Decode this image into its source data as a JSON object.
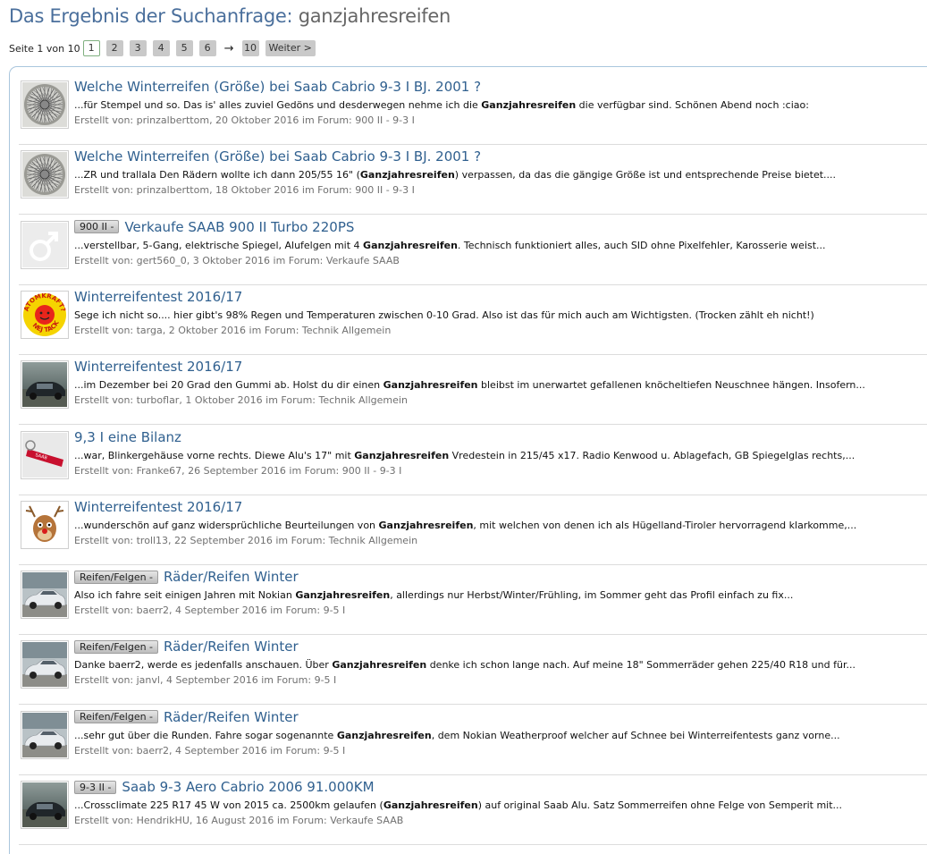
{
  "header": {
    "label": "Das Ergebnis der Suchanfrage:",
    "term": "ganzjahresreifen"
  },
  "pagination": {
    "info": "Seite 1 von 10",
    "pages": [
      "1",
      "2",
      "3",
      "4",
      "5",
      "6"
    ],
    "current": "1",
    "ellipsis": "→",
    "last": "10",
    "next": "Weiter >"
  },
  "results": [
    {
      "prefix": "",
      "title": "Welche Winterreifen (Größe) bei Saab Cabrio 9-3 I BJ. 2001 ?",
      "snippet_before": "...für Stempel und so. Das is' alles zuviel Gedöns und desderwegen nehme ich die ",
      "snippet_match": "Ganzjahresreifen",
      "snippet_after": " die verfügbar sind. Schönen Abend noch :ciao:",
      "meta": "Erstellt von: prinzalberttom, 20 Oktober 2016 im Forum: 900 II - 9-3 I",
      "icon": "wire-wheel-icon"
    },
    {
      "prefix": "",
      "title": "Welche Winterreifen (Größe) bei Saab Cabrio 9-3 I BJ. 2001 ?",
      "snippet_before": "...ZR und trallala Den Rädern wollte ich dann 205/55 16\" (",
      "snippet_match": "Ganzjahresreifen",
      "snippet_after": ") verpassen, da das die gängige Größe ist und entsprechende Preise bietet....",
      "meta": "Erstellt von: prinzalberttom, 18 Oktober 2016 im Forum: 900 II - 9-3 I",
      "icon": "wire-wheel-icon"
    },
    {
      "prefix": "900 II -",
      "title": "Verkaufe SAAB 900 II Turbo 220PS",
      "snippet_before": "...verstellbar, 5-Gang, elektrische Spiegel, Alufelgen mit 4 ",
      "snippet_match": "Ganzjahresreifen",
      "snippet_after": ". Technisch funktioniert alles, auch SID ohne Pixelfehler, Karosserie weist...",
      "meta": "Erstellt von: gert560_0, 3 Oktober 2016 im Forum: Verkaufe SAAB",
      "icon": "male-symbol-icon"
    },
    {
      "prefix": "",
      "title": "Winterreifentest 2016/17",
      "snippet_before": "Sege ich nicht so.... hier gibt's 98% Regen und Temperaturen zwischen 0-10 Grad. Also ist das für mich auch am Wichtigsten. (Trocken zählt eh nicht!)",
      "snippet_match": "",
      "snippet_after": "",
      "meta": "Erstellt von: targa, 2 Oktober 2016 im Forum: Technik Allgemein",
      "icon": "atomkraft-badge-icon",
      "badge_top": "ATOMKRAFT?",
      "badge_bottom": "NEJ TACK"
    },
    {
      "prefix": "",
      "title": "Winterreifentest 2016/17",
      "snippet_before": "...im Dezember bei 20 Grad den Gummi ab. Holst du dir einen ",
      "snippet_match": "Ganzjahresreifen",
      "snippet_after": " bleibst im unerwartet gefallenen knöcheltiefen Neuschnee hängen. Insofern...",
      "meta": "Erstellt von: turboflar, 1 Oktober 2016 im Forum: Technik Allgemein",
      "icon": "dark-car-photo-icon"
    },
    {
      "prefix": "",
      "title": "9,3 I eine Bilanz",
      "snippet_before": "...war, Blinkergehäuse vorne rechts. Diewe Alu's 17\" mit ",
      "snippet_match": "Ganzjahresreifen",
      "snippet_after": " Vredestein in 215/45 x17. Radio Kenwood u. Ablagefach, GB Spiegelglas rechts,...",
      "meta": "Erstellt von: Franke67, 26 September 2016 im Forum: 900 II - 9-3 I",
      "icon": "keychain-photo-icon"
    },
    {
      "prefix": "",
      "title": "Winterreifentest 2016/17",
      "snippet_before": "...wunderschön auf ganz widersprüchliche Beurteilungen von ",
      "snippet_match": "Ganzjahresreifen",
      "snippet_after": ", mit welchen von denen ich als Hügelland-Tiroler hervorragend klarkomme,...",
      "meta": "Erstellt von: troll13, 22 September 2016 im Forum: Technik Allgemein",
      "icon": "reindeer-icon"
    },
    {
      "prefix": "Reifen/Felgen -",
      "title": "Räder/Reifen Winter",
      "snippet_before": "Also ich fahre seit einigen Jahren mit Nokian ",
      "snippet_match": "Ganzjahresreifen",
      "snippet_after": ", allerdings nur Herbst/Winter/Frühling, im Sommer geht das Profil einfach zu fix...",
      "meta": "Erstellt von: baerr2, 4 September 2016 im Forum: 9-5 I",
      "icon": "silver-car-photo-icon"
    },
    {
      "prefix": "Reifen/Felgen -",
      "title": "Räder/Reifen Winter",
      "snippet_before": "Danke baerr2, werde es jedenfalls anschauen. Über ",
      "snippet_match": "Ganzjahresreifen",
      "snippet_after": " denke ich schon lange nach. Auf meine 18\" Sommerräder gehen 225/40 R18 und für...",
      "meta": "Erstellt von: janvl, 4 September 2016 im Forum: 9-5 I",
      "icon": "silver-car-photo-icon"
    },
    {
      "prefix": "Reifen/Felgen -",
      "title": "Räder/Reifen Winter",
      "snippet_before": "...sehr gut über die Runden. Fahre sogar sogenannte ",
      "snippet_match": "Ganzjahresreifen",
      "snippet_after": ", dem Nokian Weatherproof welcher auf Schnee bei Winterreifentests ganz vorne...",
      "meta": "Erstellt von: baerr2, 4 September 2016 im Forum: 9-5 I",
      "icon": "silver-car-photo-icon"
    },
    {
      "prefix": "9-3 II -",
      "title": "Saab 9-3 Aero Cabrio 2006 91.000KM",
      "snippet_before": "...Crossclimate 225 R17 45 W von 2015 ca. 2500km gelaufen (",
      "snippet_match": "Ganzjahresreifen",
      "snippet_after": ") auf original Saab Alu. Satz Sommerreifen ohne Felge von Semperit mit...",
      "meta": "Erstellt von: HendrikHU, 16 August 2016 im Forum: Verkaufe SAAB",
      "icon": "dark-car-photo-icon"
    }
  ]
}
